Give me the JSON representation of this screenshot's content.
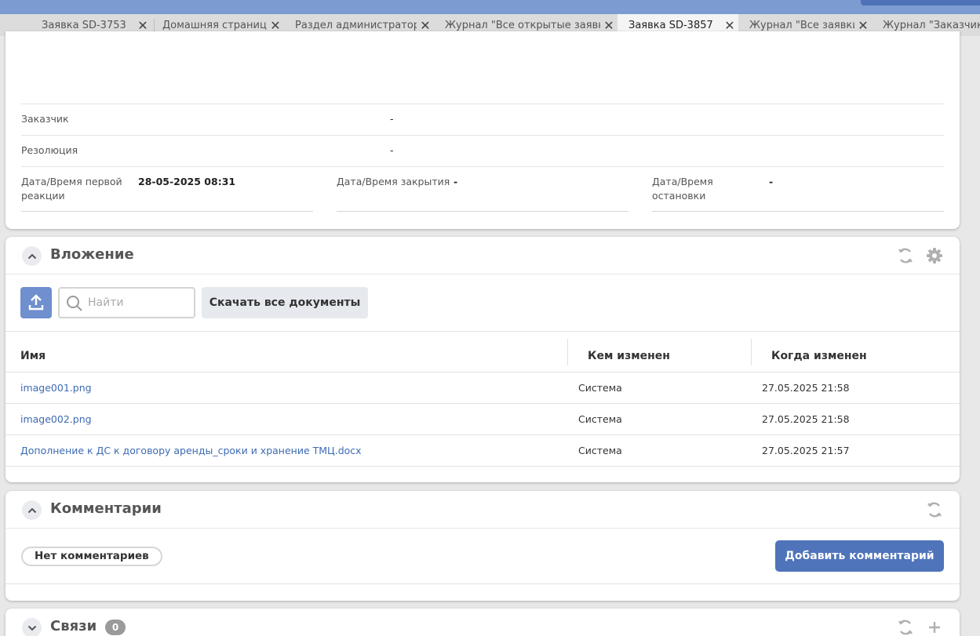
{
  "tabs": [
    {
      "label": "Заявка SD-3753",
      "active": false
    },
    {
      "label": "Домашняя страница",
      "active": false
    },
    {
      "label": "Раздел администратора",
      "active": false
    },
    {
      "label": "Журнал \"Все открытые заявки\"",
      "active": false
    },
    {
      "label": "Заявка SD-3857",
      "active": true
    },
    {
      "label": "Журнал \"Все заявки\"",
      "active": false
    },
    {
      "label": "Журнал \"Заказчики\"",
      "active": false
    }
  ],
  "details": {
    "customer_label": "Заказчик",
    "customer_value": "-",
    "resolution_label": "Резолюция",
    "resolution_value": "-",
    "first_reaction_label_1": "Дата/Время первой",
    "first_reaction_label_2": "реакции",
    "first_reaction_value": "28-05-2025 08:31",
    "closed_label": "Дата/Время закрытия",
    "closed_value": "-",
    "stop_label_1": "Дата/Время",
    "stop_label_2": "остановки",
    "stop_value": "-"
  },
  "attachments": {
    "title": "Вложение",
    "search_placeholder": "Найти",
    "download_all": "Скачать все документы",
    "columns": [
      "Имя",
      "Кем изменен",
      "Когда изменен"
    ],
    "rows": [
      {
        "name": "image001.png",
        "by": "Система",
        "when": "27.05.2025 21:58"
      },
      {
        "name": "image002.png",
        "by": "Система",
        "when": "27.05.2025 21:58"
      },
      {
        "name": "Дополнение к ДС к договору аренды_сроки и хранение ТМЦ.docx",
        "by": "Система",
        "when": "27.05.2025 21:57"
      }
    ]
  },
  "comments": {
    "title": "Комментарии",
    "empty": "Нет комментариев",
    "add": "Добавить комментарий"
  },
  "links": {
    "title": "Связи",
    "count": "0"
  },
  "icons": {
    "close": "close-icon",
    "refresh": "refresh-icon",
    "settings": "gear-icon",
    "upload": "upload-icon",
    "search": "search-icon",
    "collapse": "chevron-up-icon",
    "expand": "chevron-down-icon",
    "add": "plus-icon"
  },
  "colors": {
    "accent": "#4f74ba",
    "link": "#3d6bb3",
    "topbar": "#7b9bd1"
  }
}
